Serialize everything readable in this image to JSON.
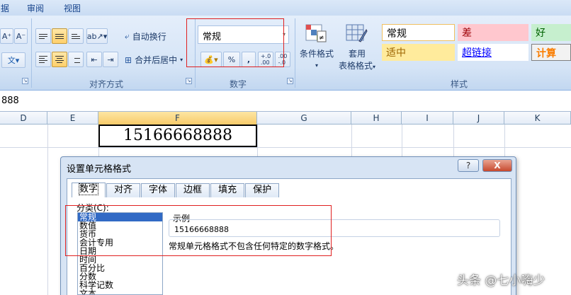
{
  "menu": {
    "item_partial": "据",
    "review": "审阅",
    "view": "视图"
  },
  "ribbon": {
    "font": {
      "grow": "A⁺",
      "shrink": "A⁻",
      "phonetic": "文"
    },
    "alignment": {
      "label": "对齐方式",
      "wrap_text": "自动换行",
      "merge_center": "合并后居中"
    },
    "number": {
      "label": "数字",
      "format_value": "常规",
      "percent": "%",
      "comma": ",",
      "inc_decimal": "←.0 .00",
      "dec_decimal": ".00 →.0"
    },
    "styles": {
      "label": "样式",
      "conditional_format": "条件格式",
      "format_as_table_1": "套用",
      "format_as_table_2": "表格格式",
      "cells": [
        {
          "text": "常规",
          "color": "#000000",
          "bg": "#ffffff",
          "border": "#f0c060"
        },
        {
          "text": "差",
          "color": "#9c0006",
          "bg": "#ffc7ce",
          "border": "none"
        },
        {
          "text": "好",
          "color": "#006100",
          "bg": "#c6efce",
          "border": "none"
        },
        {
          "text": "适中",
          "color": "#9c6500",
          "bg": "#ffeb9c",
          "border": "none"
        },
        {
          "text": "超链接",
          "color": "#0000ff",
          "bg": "#ffffff",
          "border": "none"
        },
        {
          "text": "计算",
          "color": "#fa7d00",
          "bg": "#f2f2f2",
          "border": "#7f7f7f"
        }
      ]
    }
  },
  "formula_bar": {
    "value": "888"
  },
  "columns": [
    "D",
    "E",
    "F",
    "G",
    "H",
    "I",
    "J",
    "K"
  ],
  "active_cell": {
    "value": "15166668888"
  },
  "dialog": {
    "title": "设置单元格格式",
    "help": "?",
    "close": "X",
    "tabs": [
      "数字",
      "对齐",
      "字体",
      "边框",
      "填充",
      "保护"
    ],
    "category_label": "分类(C):",
    "categories": [
      "常规",
      "数值",
      "货币",
      "会计专用",
      "日期",
      "时间",
      "百分比",
      "分数",
      "科学记数",
      "文本"
    ],
    "sample_label": "示例",
    "sample_value": "15166668888",
    "description": "常规单元格格式不包含任何特定的数字格式。"
  },
  "watermark": "头条 @七小嗨少"
}
